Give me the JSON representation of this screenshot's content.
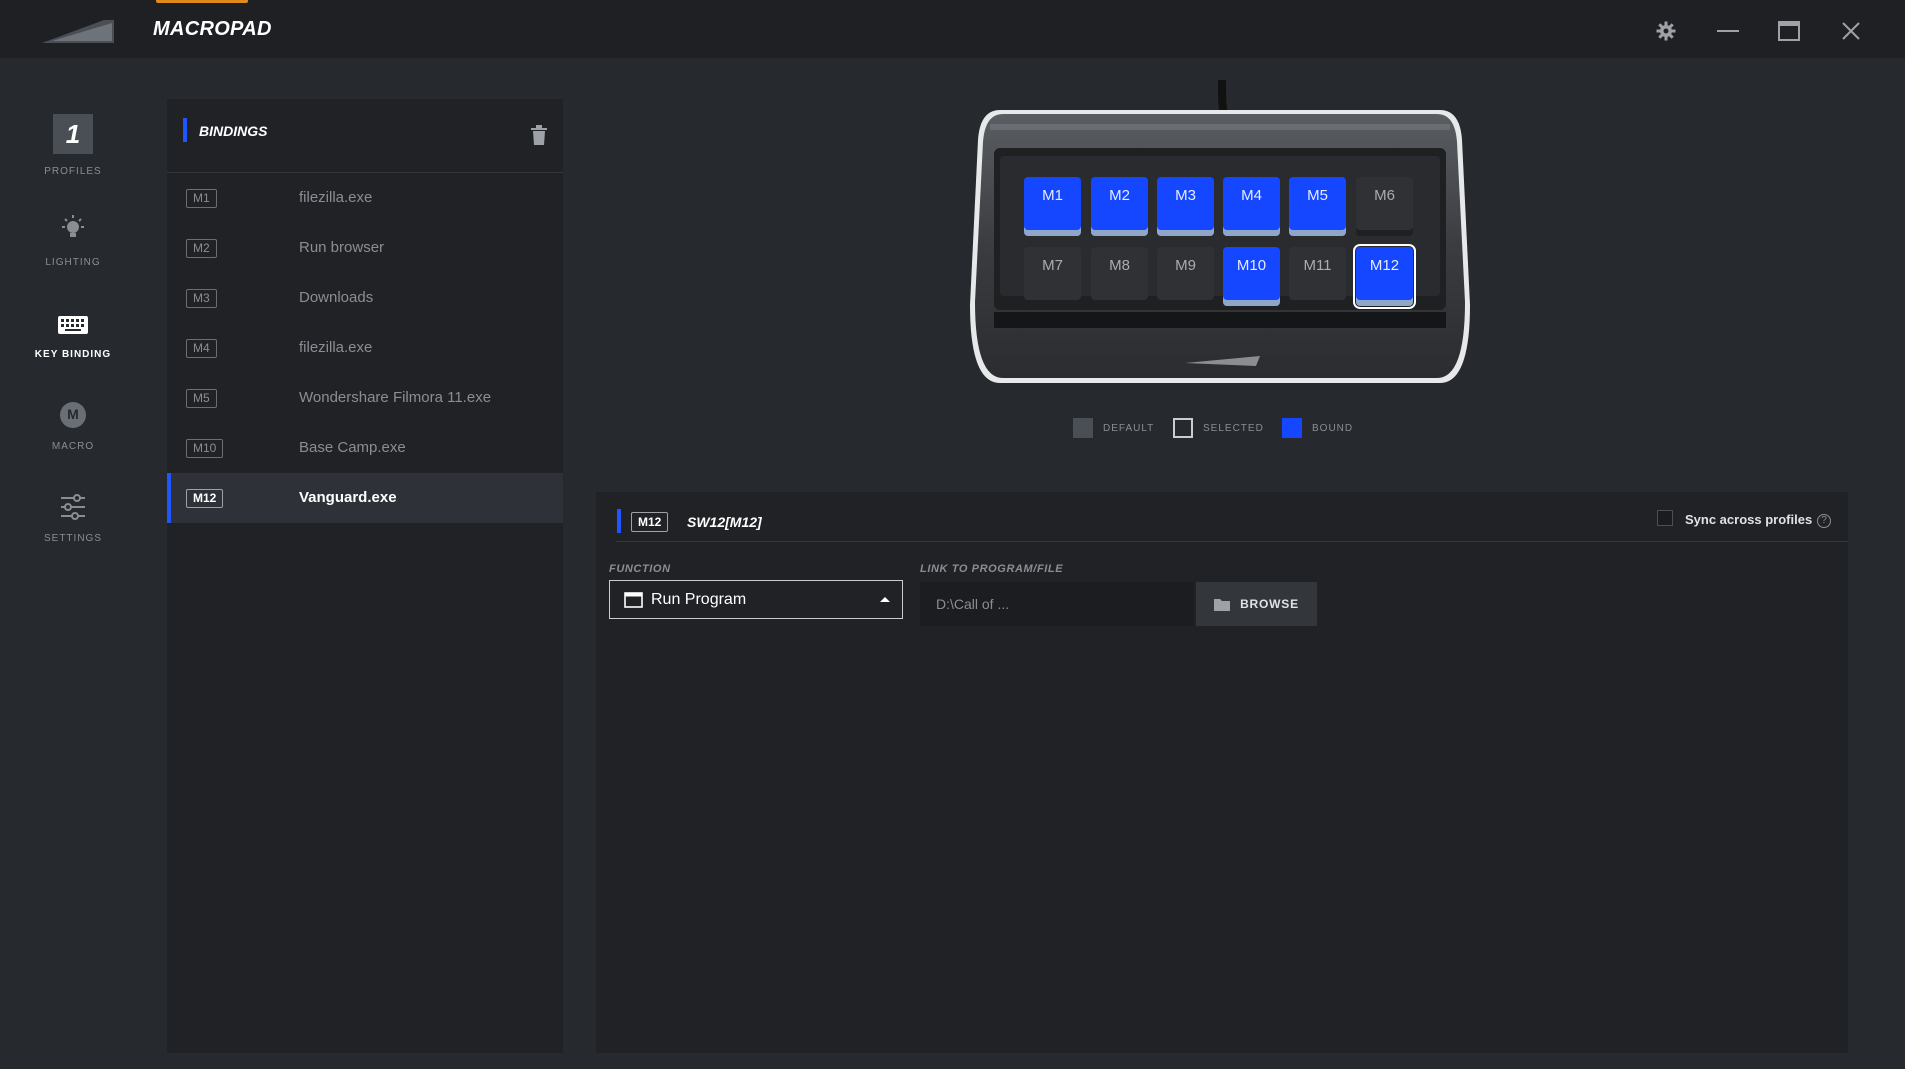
{
  "app": {
    "title": "MACROPAD"
  },
  "nav": {
    "profile_number": "1",
    "items": [
      {
        "label": "PROFILES",
        "icon": "profile-number-badge"
      },
      {
        "label": "LIGHTING",
        "icon": "lightbulb-icon"
      },
      {
        "label": "KEY BINDING",
        "icon": "keyboard-icon",
        "active": true
      },
      {
        "label": "MACRO",
        "icon": "macro-icon",
        "glyph": "M"
      },
      {
        "label": "SETTINGS",
        "icon": "sliders-icon"
      }
    ]
  },
  "bindings": {
    "title": "BINDINGS",
    "rows": [
      {
        "key": "M1",
        "name": "filezilla.exe"
      },
      {
        "key": "M2",
        "name": "Run browser"
      },
      {
        "key": "M3",
        "name": "Downloads"
      },
      {
        "key": "M4",
        "name": "filezilla.exe"
      },
      {
        "key": "M5",
        "name": "Wondershare Filmora 11.exe"
      },
      {
        "key": "M10",
        "name": "Base Camp.exe"
      },
      {
        "key": "M12",
        "name": "Vanguard.exe",
        "selected": true
      }
    ]
  },
  "device": {
    "keys": [
      {
        "label": "M1",
        "state": "bound"
      },
      {
        "label": "M2",
        "state": "bound"
      },
      {
        "label": "M3",
        "state": "bound"
      },
      {
        "label": "M4",
        "state": "bound"
      },
      {
        "label": "M5",
        "state": "bound"
      },
      {
        "label": "M6",
        "state": "default"
      },
      {
        "label": "M7",
        "state": "default"
      },
      {
        "label": "M8",
        "state": "default"
      },
      {
        "label": "M9",
        "state": "default"
      },
      {
        "label": "M10",
        "state": "bound"
      },
      {
        "label": "M11",
        "state": "default"
      },
      {
        "label": "M12",
        "state": "bound-selected"
      }
    ]
  },
  "legend": {
    "default_label": "DEFAULT",
    "selected_label": "SELECTED",
    "bound_label": "BOUND"
  },
  "editor": {
    "key": "M12",
    "title": "SW12[M12]",
    "sync_label": "Sync across profiles",
    "help_glyph": "?",
    "function_label": "FUNCTION",
    "function_value": "Run Program",
    "link_label": "LINK TO PROGRAM/FILE",
    "link_value": "D:\\Call of ...",
    "browse_label": "BROWSE"
  },
  "colors": {
    "accent_blue": "#1e56ff",
    "bound_key": "#1447ff",
    "title_accent": "#e08a1e",
    "background": "#26292e",
    "panel": "#202226"
  }
}
